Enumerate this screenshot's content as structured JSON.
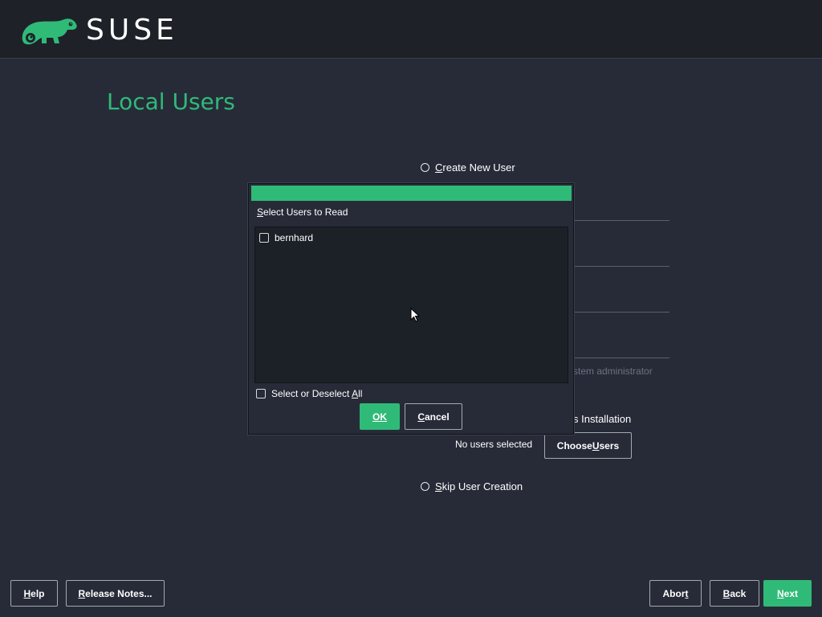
{
  "header": {
    "brand": "SUSE",
    "logo_icon": "chameleon-icon"
  },
  "page": {
    "title": "Local Users"
  },
  "options": {
    "create_new_user": {
      "label": "Create New User",
      "mnemonic": "C",
      "rest": "reate New User"
    },
    "skip_user_creation": {
      "label": "Skip User Creation",
      "mnemonic": "S",
      "rest": "kip User Creation"
    }
  },
  "background": {
    "admin_hint_fragment": "ystem administrator",
    "import_fragment": "s Installation",
    "no_users_text": "No users selected",
    "choose_users": {
      "label": "Choose Users",
      "before": "Choose ",
      "mnemonic": "U",
      "after": "sers"
    }
  },
  "dialog": {
    "label": {
      "text": "Select Users to Read",
      "mnemonic": "S",
      "rest": "elect Users to Read"
    },
    "users": [
      {
        "name": "bernhard",
        "checked": false
      }
    ],
    "select_all": {
      "text": "Select or Deselect All",
      "before": "Select or Deselect ",
      "mnemonic": "A",
      "after": "ll",
      "checked": false
    },
    "ok_button": {
      "label": "OK"
    },
    "cancel_button": {
      "label": "Cancel",
      "mnemonic": "C",
      "rest": "ancel"
    }
  },
  "footer": {
    "help": {
      "label": "Help",
      "mnemonic": "H",
      "rest": "elp"
    },
    "release_notes": {
      "label": "Release Notes...",
      "mnemonic": "R",
      "rest": "elease Notes..."
    },
    "abort": {
      "label": "Abort",
      "before": "Abor",
      "mnemonic": "t"
    },
    "back": {
      "label": "Back",
      "mnemonic": "B",
      "rest": "ack"
    },
    "next": {
      "label": "Next",
      "mnemonic": "N",
      "rest": "ext"
    }
  },
  "colors": {
    "accent": "#30ba78",
    "background": "#272b38",
    "header": "#1e2228"
  }
}
